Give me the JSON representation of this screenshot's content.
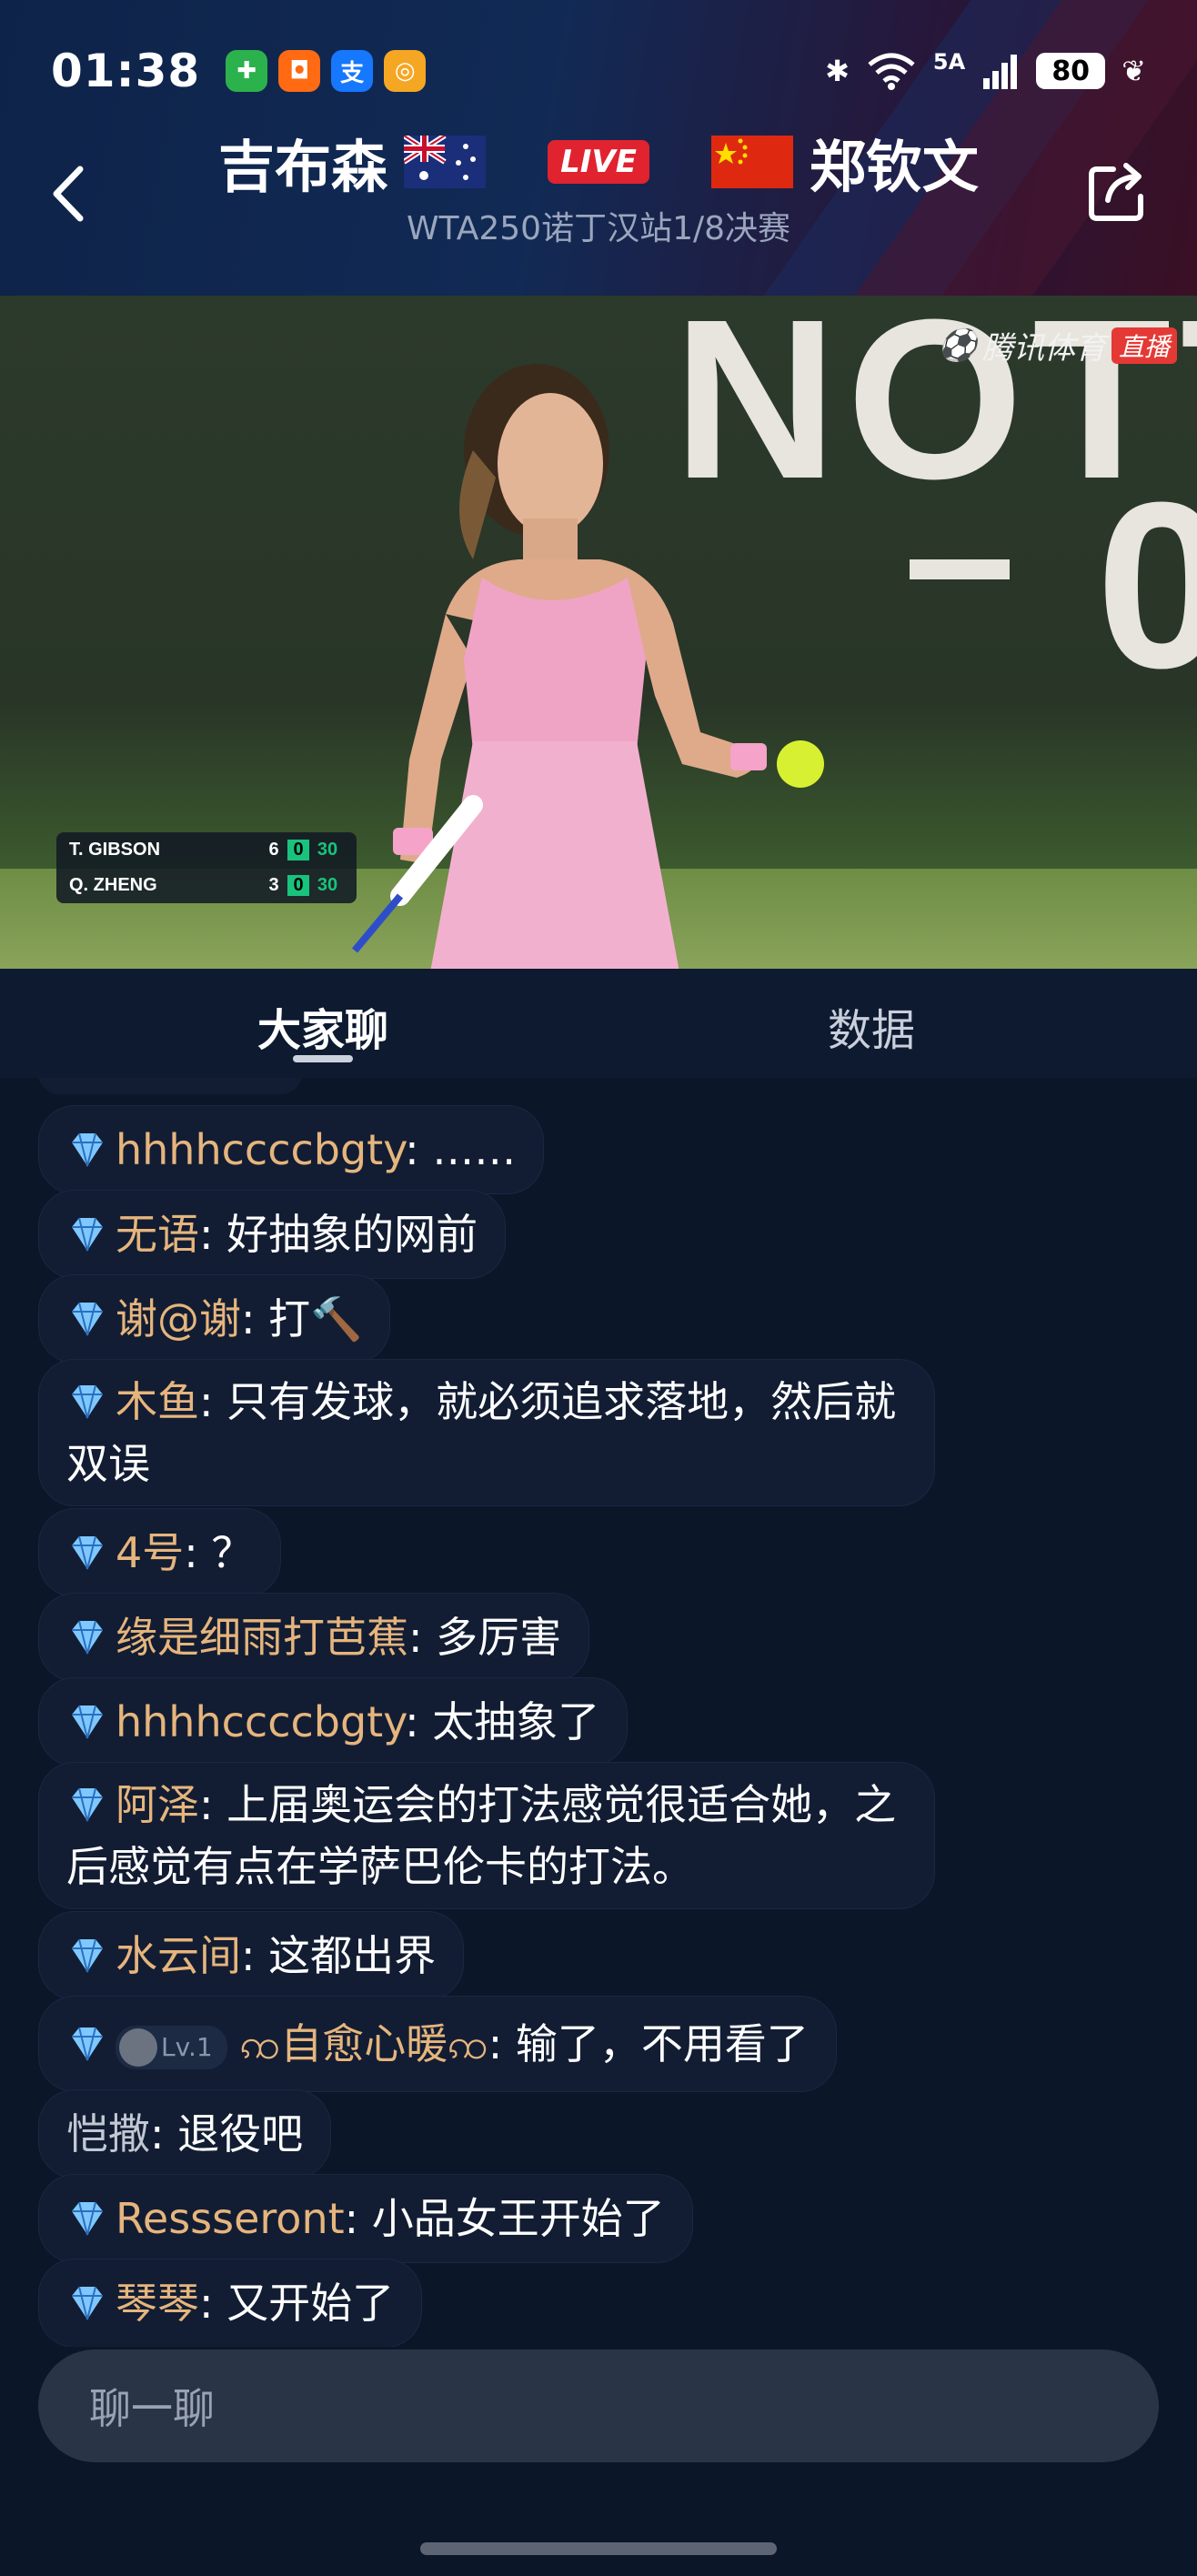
{
  "status_bar": {
    "time": "01:38",
    "signal": "5A",
    "battery": "80"
  },
  "header": {
    "team_left": "吉布森",
    "team_right": "郑钦文",
    "live_badge": "LIVE",
    "subtitle": "WTA250诺丁汉站1/8决赛"
  },
  "video": {
    "watermark": "腾讯体育",
    "watermark_badge": "直播",
    "scoreboard": [
      {
        "name": "T. GIBSON",
        "set": "6",
        "game": "0",
        "points": "30"
      },
      {
        "name": "Q. ZHENG",
        "set": "3",
        "game": "0",
        "points": "30"
      }
    ]
  },
  "tabs": {
    "chat": "大家聊",
    "data": "数据"
  },
  "chat": {
    "messages": [
      {
        "user": "hhhhccccbgty",
        "text": "……"
      },
      {
        "user": "无语",
        "text": "好抽象的网前"
      },
      {
        "user": "谢@谢",
        "text": "打🔨"
      },
      {
        "user": "木鱼",
        "text": "只有发球，就必须追求落地，然后就双误"
      },
      {
        "user": "4号",
        "text": "？"
      },
      {
        "user": "缘是细雨打芭蕉",
        "text": "多厉害"
      },
      {
        "user": "hhhhccccbgty",
        "text": "太抽象了"
      },
      {
        "user": "阿泽",
        "text": "上届奥运会的打法感觉很适合她，之后感觉有点在学萨巴伦卡的打法。"
      },
      {
        "user": "水云间",
        "text": "这都出界"
      },
      {
        "user": "ꩡ自愈心暖ꩡ",
        "level": "Lv.1",
        "text": "输了，不用看了"
      },
      {
        "user": "恺撒",
        "text": "退役吧"
      },
      {
        "user": "Ressseront",
        "text": "小品女王开始了"
      },
      {
        "user": "琴琴",
        "text": "又开始了"
      }
    ]
  },
  "input": {
    "placeholder": "聊一聊"
  },
  "colors": {
    "background": "#0b1629",
    "username": "#e6b57d",
    "live": "#e0232e",
    "input_bg": "#2a3447"
  }
}
